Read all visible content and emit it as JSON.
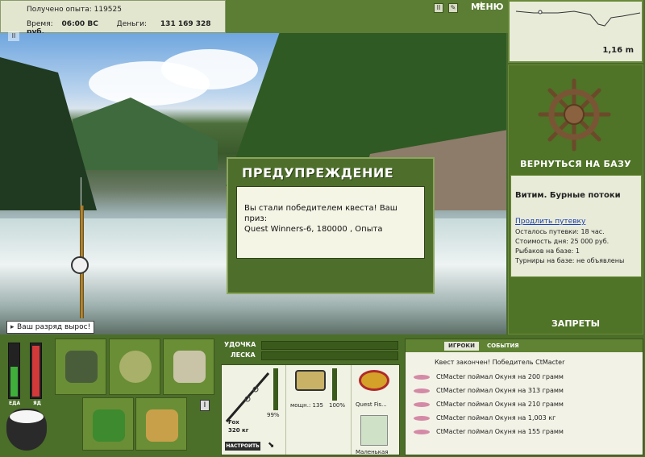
{
  "stats": {
    "xp_label": "Получено опыта:",
    "xp_value": "119525",
    "time_label": "Время:",
    "time_value": "06:00 ВС",
    "money_label": "Деньги:",
    "money_value": "131 169 328 руб."
  },
  "toolbar": {
    "pause_icon": "pause-icon",
    "settings_icon": "wrench-icon",
    "menu_label": "МЕНЮ"
  },
  "depth": {
    "value": "1,16 m"
  },
  "warning": {
    "title": "ПРЕДУПРЕЖДЕНИЕ",
    "message_line1": "Вы стали победителем квеста! Ваш приз:",
    "message_line2": "Quest Winners-6, 180000 , Опыта"
  },
  "scene": {
    "rank_tip": "Ваш разряд вырос!"
  },
  "right_panel": {
    "return_label": "ВЕРНУТЬСЯ НА БАЗУ",
    "location_name": "Витим. Бурные потоки",
    "extend_link": "Продлить путевку",
    "remaining": "Осталось путевки: 18 час.",
    "day_cost": "Стоимость дня: 25 000 руб.",
    "anglers": "Рыбаков на базе: 1",
    "tournaments": "Турниры на базе: не объявлены",
    "bans_label": "ЗАПРЕТЫ"
  },
  "meters": {
    "food_label": "ЕДА",
    "food_level": 0.55,
    "poison_label": "ЯД",
    "poison_level": 0.92
  },
  "tackle": {
    "rod_label": "УДОЧКА",
    "line_label": "ЛЕСКА",
    "rod_name": "Fox",
    "rod_weight": "320 кг",
    "rod_condition": "99%",
    "reel_power": "мощн.: 135",
    "reel_condition": "100%",
    "line_name": "Quest Fis...",
    "bait_name": "Маленькая",
    "tune_button": "НАСТРОИТЬ"
  },
  "events": {
    "tab_players": "ИГРОКИ",
    "tab_events": "СОБЫТИЯ",
    "header": "Квест закончен! Победитель CtMacter",
    "items": [
      "CtMacter поймал Окуня на 200 грамм",
      "CtMacter поймал Окуня на 313 грамм",
      "CtMacter поймал Окуня на 210 грамм",
      "CtMacter поймал Окуня на 1,003 кг",
      "CtMacter поймал Окуня на 155 грамм"
    ]
  },
  "colors": {
    "panel_green": "#4f7327",
    "light_panel": "#e8ebd8",
    "food_green": "#3fae3a",
    "poison_red": "#d23a3a"
  }
}
